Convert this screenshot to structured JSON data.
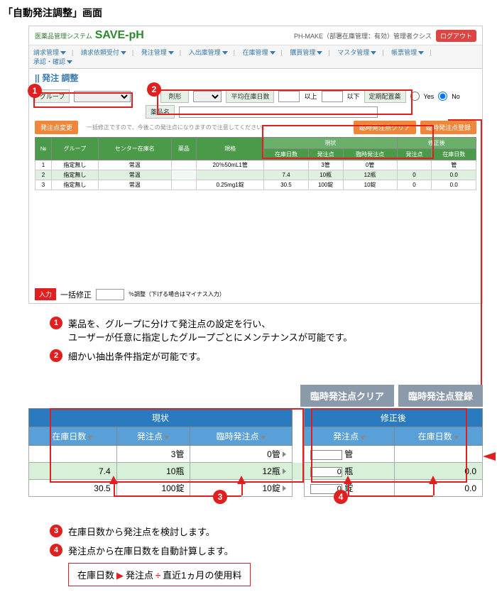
{
  "page_title": "「自動発注調整」画面",
  "app": {
    "logo_sub": "医薬品管理システム",
    "logo_main": "SAVE",
    "logo_suffix": "-pH",
    "header_right": "PH-MAKE（部署在庫管理：有効）管理者クシス",
    "logout": "ログアウト"
  },
  "menu": [
    "請求管理",
    "請求依頼受付",
    "発注管理",
    "入出庫管理",
    "在庫管理",
    "購買管理",
    "マスタ管理",
    "帳票管理",
    "承認・確認"
  ],
  "section_title": "発注 調整",
  "filter": {
    "group_label": "グループ",
    "reason_label": "剤形",
    "avg_label": "平均在庫日数",
    "gte": "以上",
    "lte": "以下",
    "fixed_label": "定期配置薬",
    "yes": "Yes",
    "no": "No",
    "drug_label": "薬品名",
    "btn_update": "発注点変更",
    "hint": "一括修正ですので、今後この発注点になりますので注意してください。",
    "btn_clear": "臨時発注点クリア",
    "btn_register": "臨時発注点登録"
  },
  "table": {
    "headers": [
      "№",
      "グループ",
      "センター在庫名",
      "薬品",
      "規格",
      "在庫日数",
      "発注点",
      "臨時発注点",
      "発注点",
      "在庫日数"
    ],
    "group_current": "現状",
    "group_after": "修正後",
    "rows": [
      {
        "no": "1",
        "group": "指定無し",
        "center": "常温",
        "drug": "",
        "spec": "20％50mL1管",
        "days": "",
        "op": "3管",
        "temp": "0管",
        "op2": "",
        "days2": "管"
      },
      {
        "no": "2",
        "group": "指定無し",
        "center": "常温",
        "drug": "",
        "spec": "",
        "days": "7.4",
        "op": "10瓶",
        "temp": "12瓶",
        "op2": "0",
        "days2": "0.0"
      },
      {
        "no": "3",
        "group": "指定無し",
        "center": "常温",
        "drug": "",
        "spec": "0.25mg1錠",
        "days": "30.5",
        "op": "100錠",
        "temp": "10錠",
        "op2": "0",
        "days2": "0.0"
      }
    ]
  },
  "input_footer": {
    "tag": "入力",
    "label": "一括修正",
    "suffix": "％調整（下げる場合はマイナス入力）"
  },
  "explain": {
    "e1a": "薬品を、グループに分けて発注点の設定を行い、",
    "e1b": "ユーザーが任意に指定したグループごとにメンテナンスが可能です。",
    "e2": "細かい抽出条件指定が可能です。",
    "e3": "在庫日数から発注点を検討します。",
    "e4": "発注点から在庫日数を自動計算します。"
  },
  "zoom": {
    "btn_clear": "臨時発注点クリア",
    "btn_register": "臨時発注点登録",
    "group_current": "現状",
    "group_after": "修正後",
    "col_days": "在庫日数",
    "col_op": "発注点",
    "col_temp": "臨時発注点",
    "rows": [
      {
        "days": "",
        "op": "3管",
        "temp": "0管",
        "op2": "",
        "unit": "管",
        "days2": ""
      },
      {
        "days": "7.4",
        "op": "10瓶",
        "temp": "12瓶",
        "op2": "0",
        "unit": "瓶",
        "days2": "0.0"
      },
      {
        "days": "30.5",
        "op": "100錠",
        "temp": "10錠",
        "op2": "0",
        "unit": "錠",
        "days2": "0.0"
      }
    ]
  },
  "formula": {
    "a": "在庫日数",
    "b": "発注点",
    "c": "直近1ヵ月の使用料"
  }
}
